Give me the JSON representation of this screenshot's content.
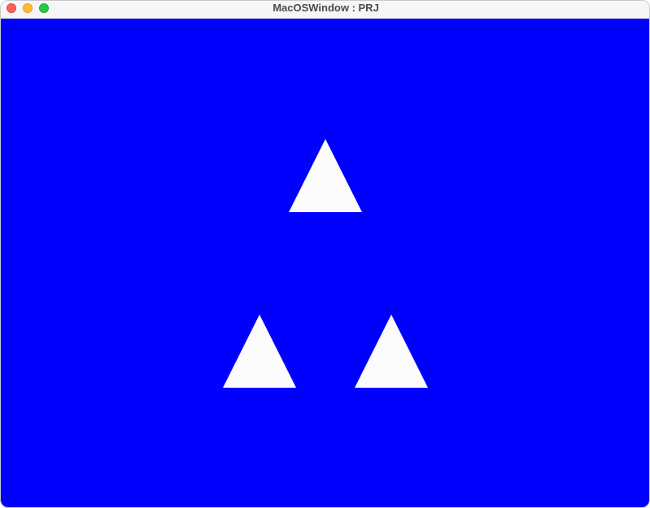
{
  "window": {
    "title": "MacOSWindow : PRJ"
  },
  "traffic_lights": {
    "close_color": "#fe5f57",
    "minimize_color": "#febc2e",
    "zoom_color": "#28c840"
  },
  "scene": {
    "background_color": "#0000ff",
    "shape_color": "#fcfcfc",
    "shape": "triangle",
    "triangle_count": 3
  }
}
